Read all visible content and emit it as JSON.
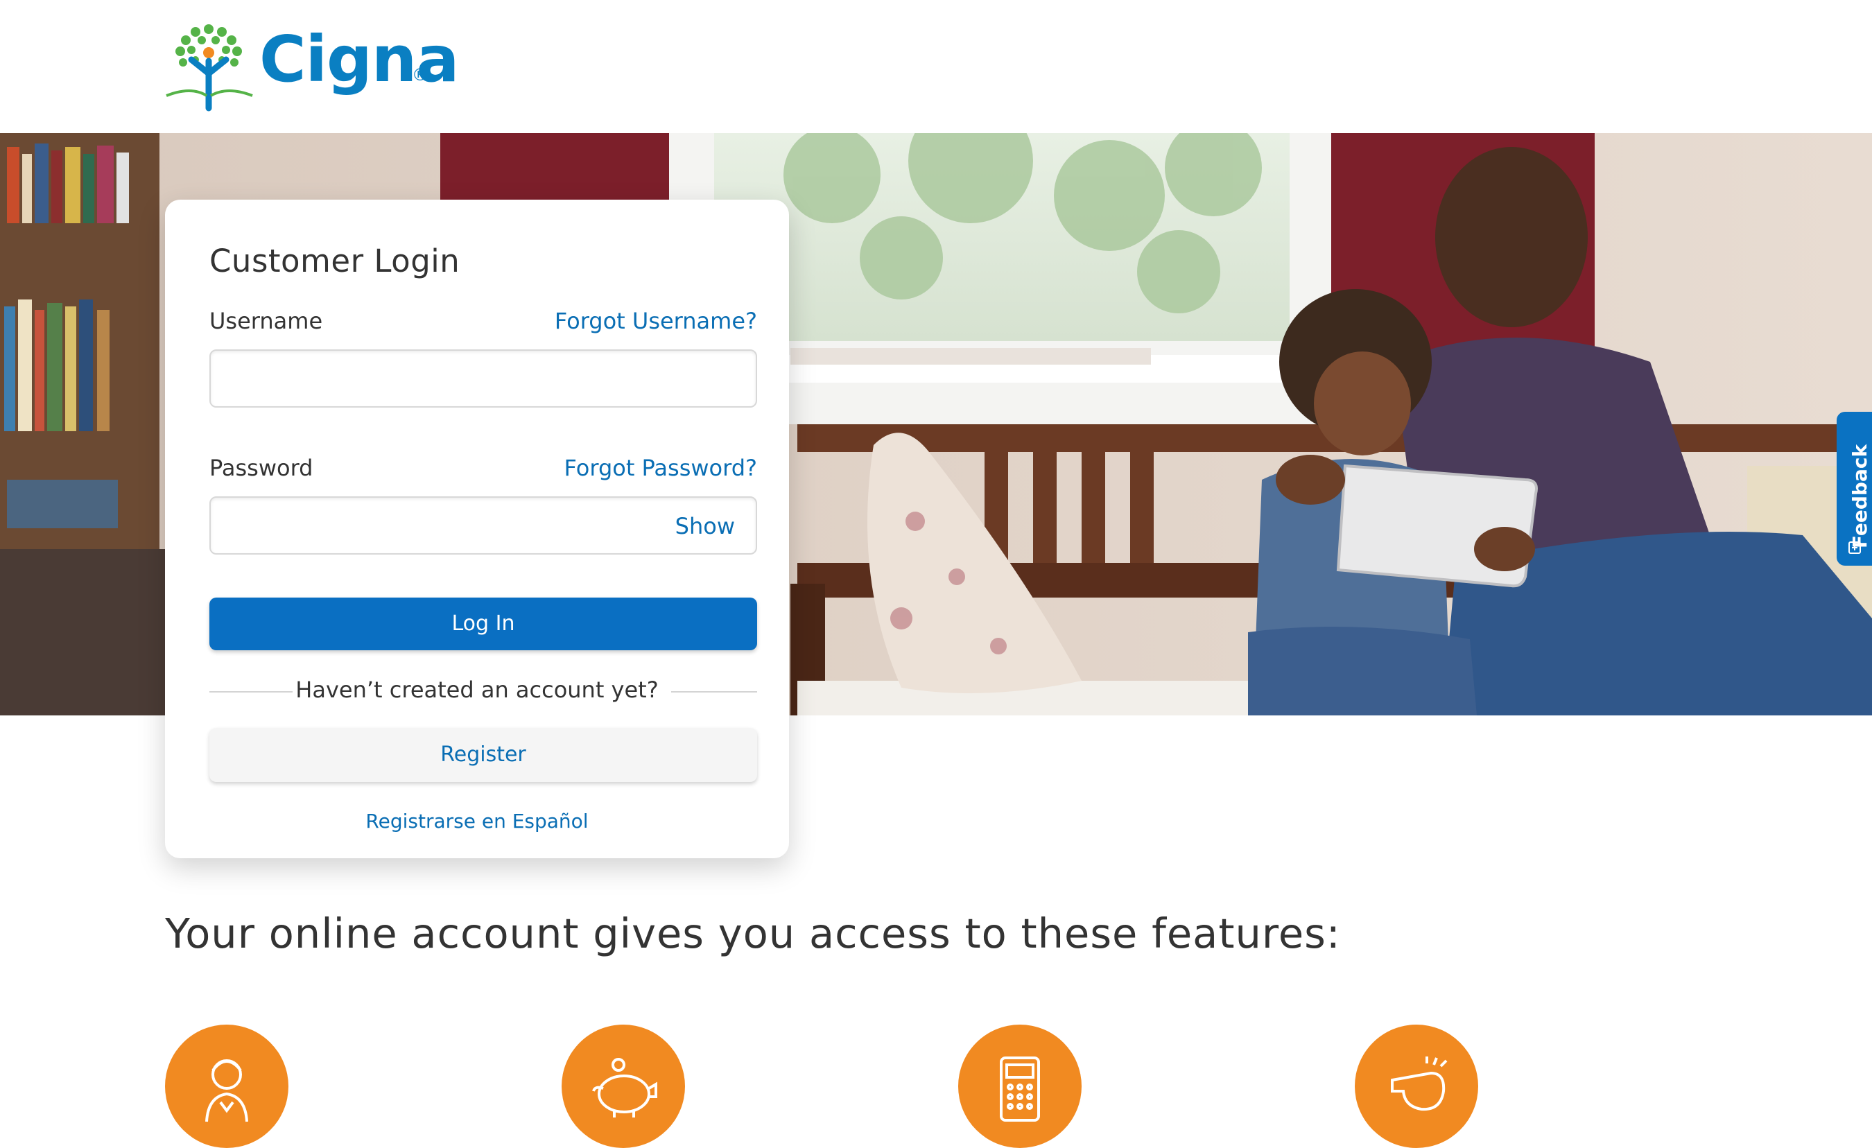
{
  "brand": {
    "name": "Cigna",
    "registered": "®",
    "accent_color": "#0a6fc2",
    "icon_color": "#f18a21"
  },
  "login": {
    "title": "Customer Login",
    "username_label": "Username",
    "forgot_username": "Forgot Username?",
    "username_value": "",
    "password_label": "Password",
    "forgot_password": "Forgot Password?",
    "password_value": "",
    "show_label": "Show",
    "login_button": "Log In",
    "no_account_text": "Haven’t created an account yet?",
    "register_button": "Register",
    "register_spanish": "Registrarse en Español"
  },
  "feedback": {
    "label": "Feedback",
    "icon": "feedback-icon"
  },
  "features": {
    "heading": "Your online account gives you access to these features:",
    "icons": [
      "doctor-icon",
      "piggy-bank-icon",
      "calculator-icon",
      "whistle-icon"
    ]
  }
}
